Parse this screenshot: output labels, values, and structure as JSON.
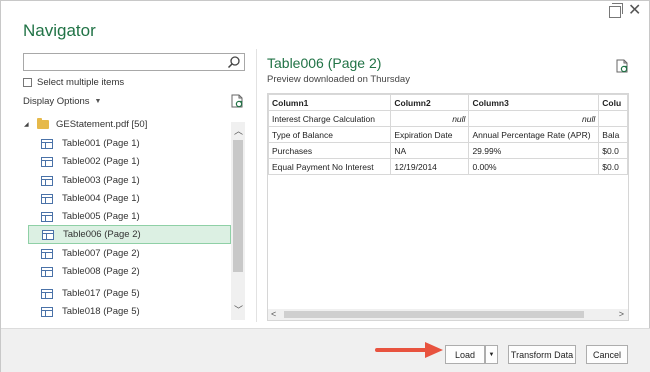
{
  "window": {
    "title": "Navigator",
    "close_glyph": "✕"
  },
  "left_pane": {
    "search_placeholder": "",
    "select_multiple_label": "Select multiple items",
    "display_options_label": "Display Options",
    "display_options_caret": "▼",
    "tree_root": {
      "label": "GEStatement.pdf [50]",
      "expander": "◢"
    },
    "tree_items": [
      {
        "label": "Table001 (Page 1)"
      },
      {
        "label": "Table002 (Page 1)"
      },
      {
        "label": "Table003 (Page 1)"
      },
      {
        "label": "Table004 (Page 1)"
      },
      {
        "label": "Table005 (Page 1)"
      },
      {
        "label": "Table006 (Page 2)",
        "selected": true
      },
      {
        "label": "Table007 (Page 2)"
      },
      {
        "label": "Table008 (Page 2)"
      },
      {
        "label": "Table017 (Page 5)"
      },
      {
        "label": "Table018 (Page 5)"
      }
    ],
    "scroll_up": "︿",
    "scroll_down": "﹀"
  },
  "preview": {
    "title": "Table006 (Page 2)",
    "subtitle": "Preview downloaded on Thursday",
    "columns": [
      "Column1",
      "Column2",
      "Column3",
      "Colu"
    ],
    "rows": [
      [
        "Interest Charge Calculation",
        "null",
        "null",
        ""
      ],
      [
        "Type of Balance",
        "Expiration Date",
        "Annual Percentage Rate (APR)",
        "Bala"
      ],
      [
        "Purchases",
        "NA",
        "29.99%",
        "$0.0"
      ],
      [
        "Equal Payment No Interest",
        "12/19/2014",
        "0.00%",
        "$0.0"
      ]
    ],
    "scroll_left": "<",
    "scroll_right": ">"
  },
  "footer": {
    "load_label": "Load",
    "load_dropdown": "▼",
    "transform_label": "Transform Data",
    "cancel_label": "Cancel"
  },
  "colors": {
    "accent": "#217346",
    "selection_bg": "#dcf0e3",
    "annotation_arrow": "#e8533f"
  },
  "icons": [
    "restore-icon",
    "close-icon",
    "search-icon",
    "refresh-icon",
    "folder-icon",
    "table-icon",
    "arrow-annotation"
  ]
}
